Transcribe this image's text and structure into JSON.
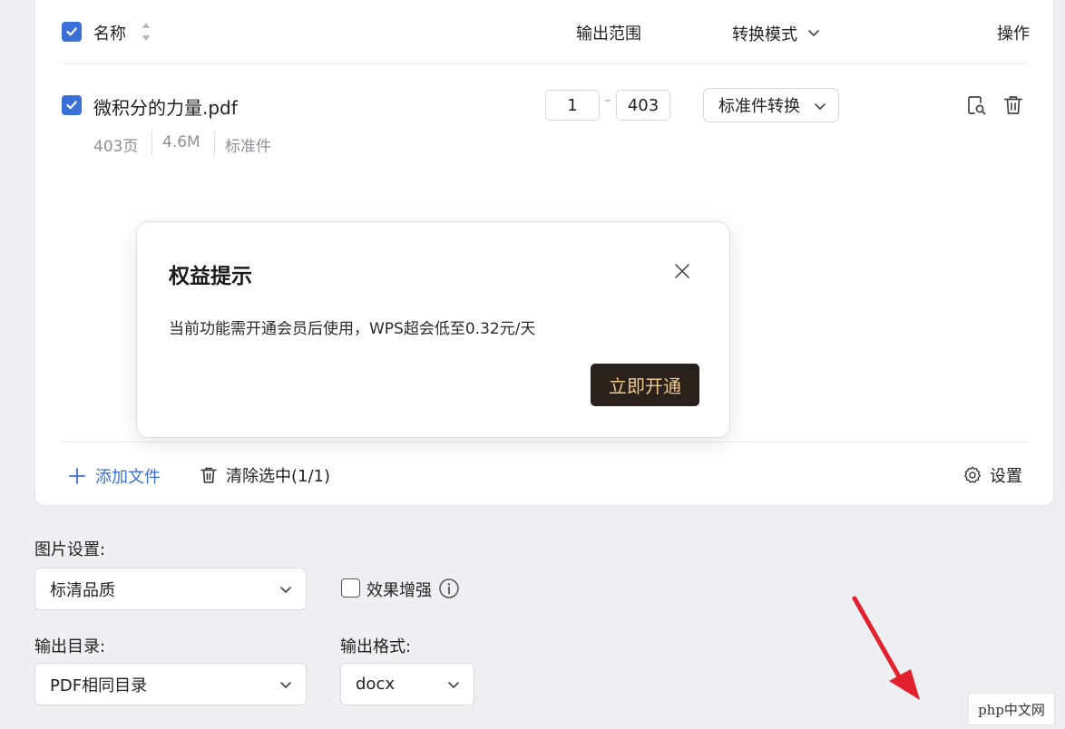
{
  "header": {
    "name_label": "名称",
    "range_label": "输出范围",
    "mode_label": "转换模式",
    "action_label": "操作"
  },
  "file": {
    "name": "微积分的力量.pdf",
    "pages": "403页",
    "size": "4.6M",
    "type": "标准件",
    "range_from": "1",
    "range_separator": "–",
    "range_to": "403",
    "mode": "标准件转换"
  },
  "footer": {
    "add_label": "添加文件",
    "clear_label": "清除选中(1/1)",
    "settings_label": "设置"
  },
  "modal": {
    "title": "权益提示",
    "message": "当前功能需开通会员后使用，WPS超会低至0.32元/天",
    "cta_label": "立即开通"
  },
  "image_settings": {
    "label": "图片设置:",
    "quality_value": "标清品质",
    "enhance_label": "效果增强"
  },
  "output": {
    "dir_label": "输出目录:",
    "dir_value": "PDF相同目录",
    "format_label": "输出格式:",
    "format_value": "docx"
  },
  "watermark": {
    "text": "php中文网"
  },
  "colors": {
    "accent": "#3b6fd8",
    "cta_bg": "#2b211c",
    "cta_text": "#f0c889",
    "arrow": "#e3202e"
  }
}
